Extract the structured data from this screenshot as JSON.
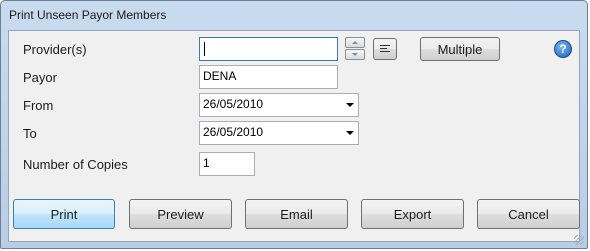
{
  "window": {
    "title": "Print Unseen Payor Members"
  },
  "form": {
    "providers_label": "Provider(s)",
    "providers_value": "",
    "payor_label": "Payor",
    "payor_value": "DENA",
    "from_label": "From",
    "from_value": "26/05/2010",
    "to_label": "To",
    "to_value": "26/05/2010",
    "copies_label": "Number of Copies",
    "copies_value": "1"
  },
  "toolbar": {
    "multiple_label": "Multiple",
    "help_glyph": "?",
    "list_icon": "list-icon"
  },
  "actions": {
    "print_label": "Print",
    "preview_label": "Preview",
    "email_label": "Email",
    "export_label": "Export",
    "cancel_label": "Cancel"
  },
  "colors": {
    "title_bar": "#c9dbef",
    "client_bg": "#f0f0f0",
    "default_button_border": "#3c7fb1",
    "help_icon": "#1c5fb6"
  }
}
